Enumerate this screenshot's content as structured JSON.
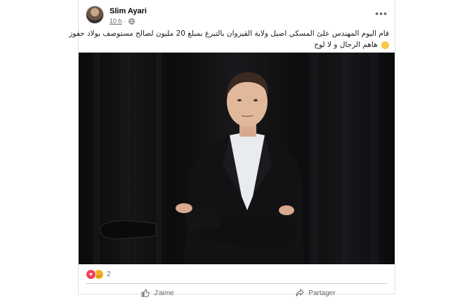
{
  "post": {
    "author": "Slim Ayari",
    "time": "10 h",
    "text_line1": "قام اليوم المهندس علئ المسكي اصيل ولاية القيروان بالتبرع بمبلغ 20 مليون لصالح مستوصف بولاد حفوز",
    "text_line2": "هاهم الرجال و لا لوح"
  },
  "reactions": {
    "count": "2",
    "types": [
      "love-icon",
      "haha-icon"
    ]
  },
  "actions": {
    "like_label": "J'aime",
    "share_label": "Partager"
  },
  "colors": {
    "love": "#f33e58",
    "haha": "#f7b125",
    "secondary_text": "#65676b"
  }
}
